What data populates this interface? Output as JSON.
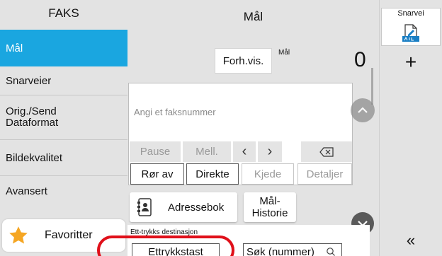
{
  "sidebar": {
    "title": "FAKS",
    "items": [
      {
        "label": "Mål"
      },
      {
        "label": "Snarveier"
      },
      {
        "label_line1": "Orig./Send",
        "label_line2": "Dataformat"
      },
      {
        "label": "Bildekvalitet"
      },
      {
        "label": "Avansert"
      }
    ],
    "favorites_label": "Favoritter"
  },
  "main": {
    "title": "Mål",
    "preview_label": "Forh.vis.",
    "destination_label": "Mål",
    "destination_count": "0",
    "fax_input_placeholder": "Angi et faksnummer",
    "keys": {
      "pause": "Pause",
      "space": "Mell.",
      "left": "‹",
      "right": "›"
    },
    "actions": {
      "on_hook": "Rør av",
      "direct": "Direkte",
      "chain": "Kjede",
      "details": "Detaljer"
    },
    "address_book_label": "Adressebok",
    "history_line1": "Mål-",
    "history_line2": "Historie",
    "one_touch": {
      "section_label": "Ett-trykks destinasjon",
      "key_label": "Ettrykkstast",
      "search_label": "Søk (nummer)"
    }
  },
  "right_panel": {
    "shortcut_label": "Snarvei",
    "shortcut_icon": "document-edit-icon",
    "add_label": "+",
    "collapse_label": "«"
  },
  "colors": {
    "active": "#1aa6e0",
    "panel_bg": "#e3e3e3",
    "highlight": "#e0101a",
    "star": "#f5a623"
  }
}
